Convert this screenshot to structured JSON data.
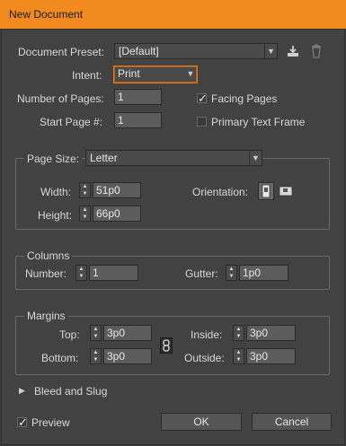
{
  "window": {
    "title": "New Document"
  },
  "preset": {
    "label": "Document Preset:",
    "value": "[Default]",
    "save_icon": "save-preset-icon",
    "delete_icon": "trash-icon"
  },
  "intent": {
    "label": "Intent:",
    "value": "Print"
  },
  "pages": {
    "label": "Number of Pages:",
    "value": "1"
  },
  "start_page": {
    "label": "Start Page #:",
    "value": "1"
  },
  "facing_pages": {
    "label": "Facing Pages",
    "checked": true
  },
  "primary_text_frame": {
    "label": "Primary Text Frame",
    "checked": false
  },
  "page_size": {
    "label": "Page Size:",
    "value": "Letter",
    "width_label": "Width:",
    "width": "51p0",
    "height_label": "Height:",
    "height": "66p0",
    "orientation_label": "Orientation:",
    "orientation": "portrait"
  },
  "columns": {
    "title": "Columns",
    "number_label": "Number:",
    "number": "1",
    "gutter_label": "Gutter:",
    "gutter": "1p0"
  },
  "margins": {
    "title": "Margins",
    "top_label": "Top:",
    "top": "3p0",
    "bottom_label": "Bottom:",
    "bottom": "3p0",
    "inside_label": "Inside:",
    "inside": "3p0",
    "outside_label": "Outside:",
    "outside": "3p0"
  },
  "bleed": {
    "label": "Bleed and Slug"
  },
  "preview": {
    "label": "Preview",
    "checked": true
  },
  "buttons": {
    "ok": "OK",
    "cancel": "Cancel"
  },
  "colors": {
    "titlebar": "#f28b1f",
    "focus": "#e07a20",
    "background": "#424242"
  }
}
